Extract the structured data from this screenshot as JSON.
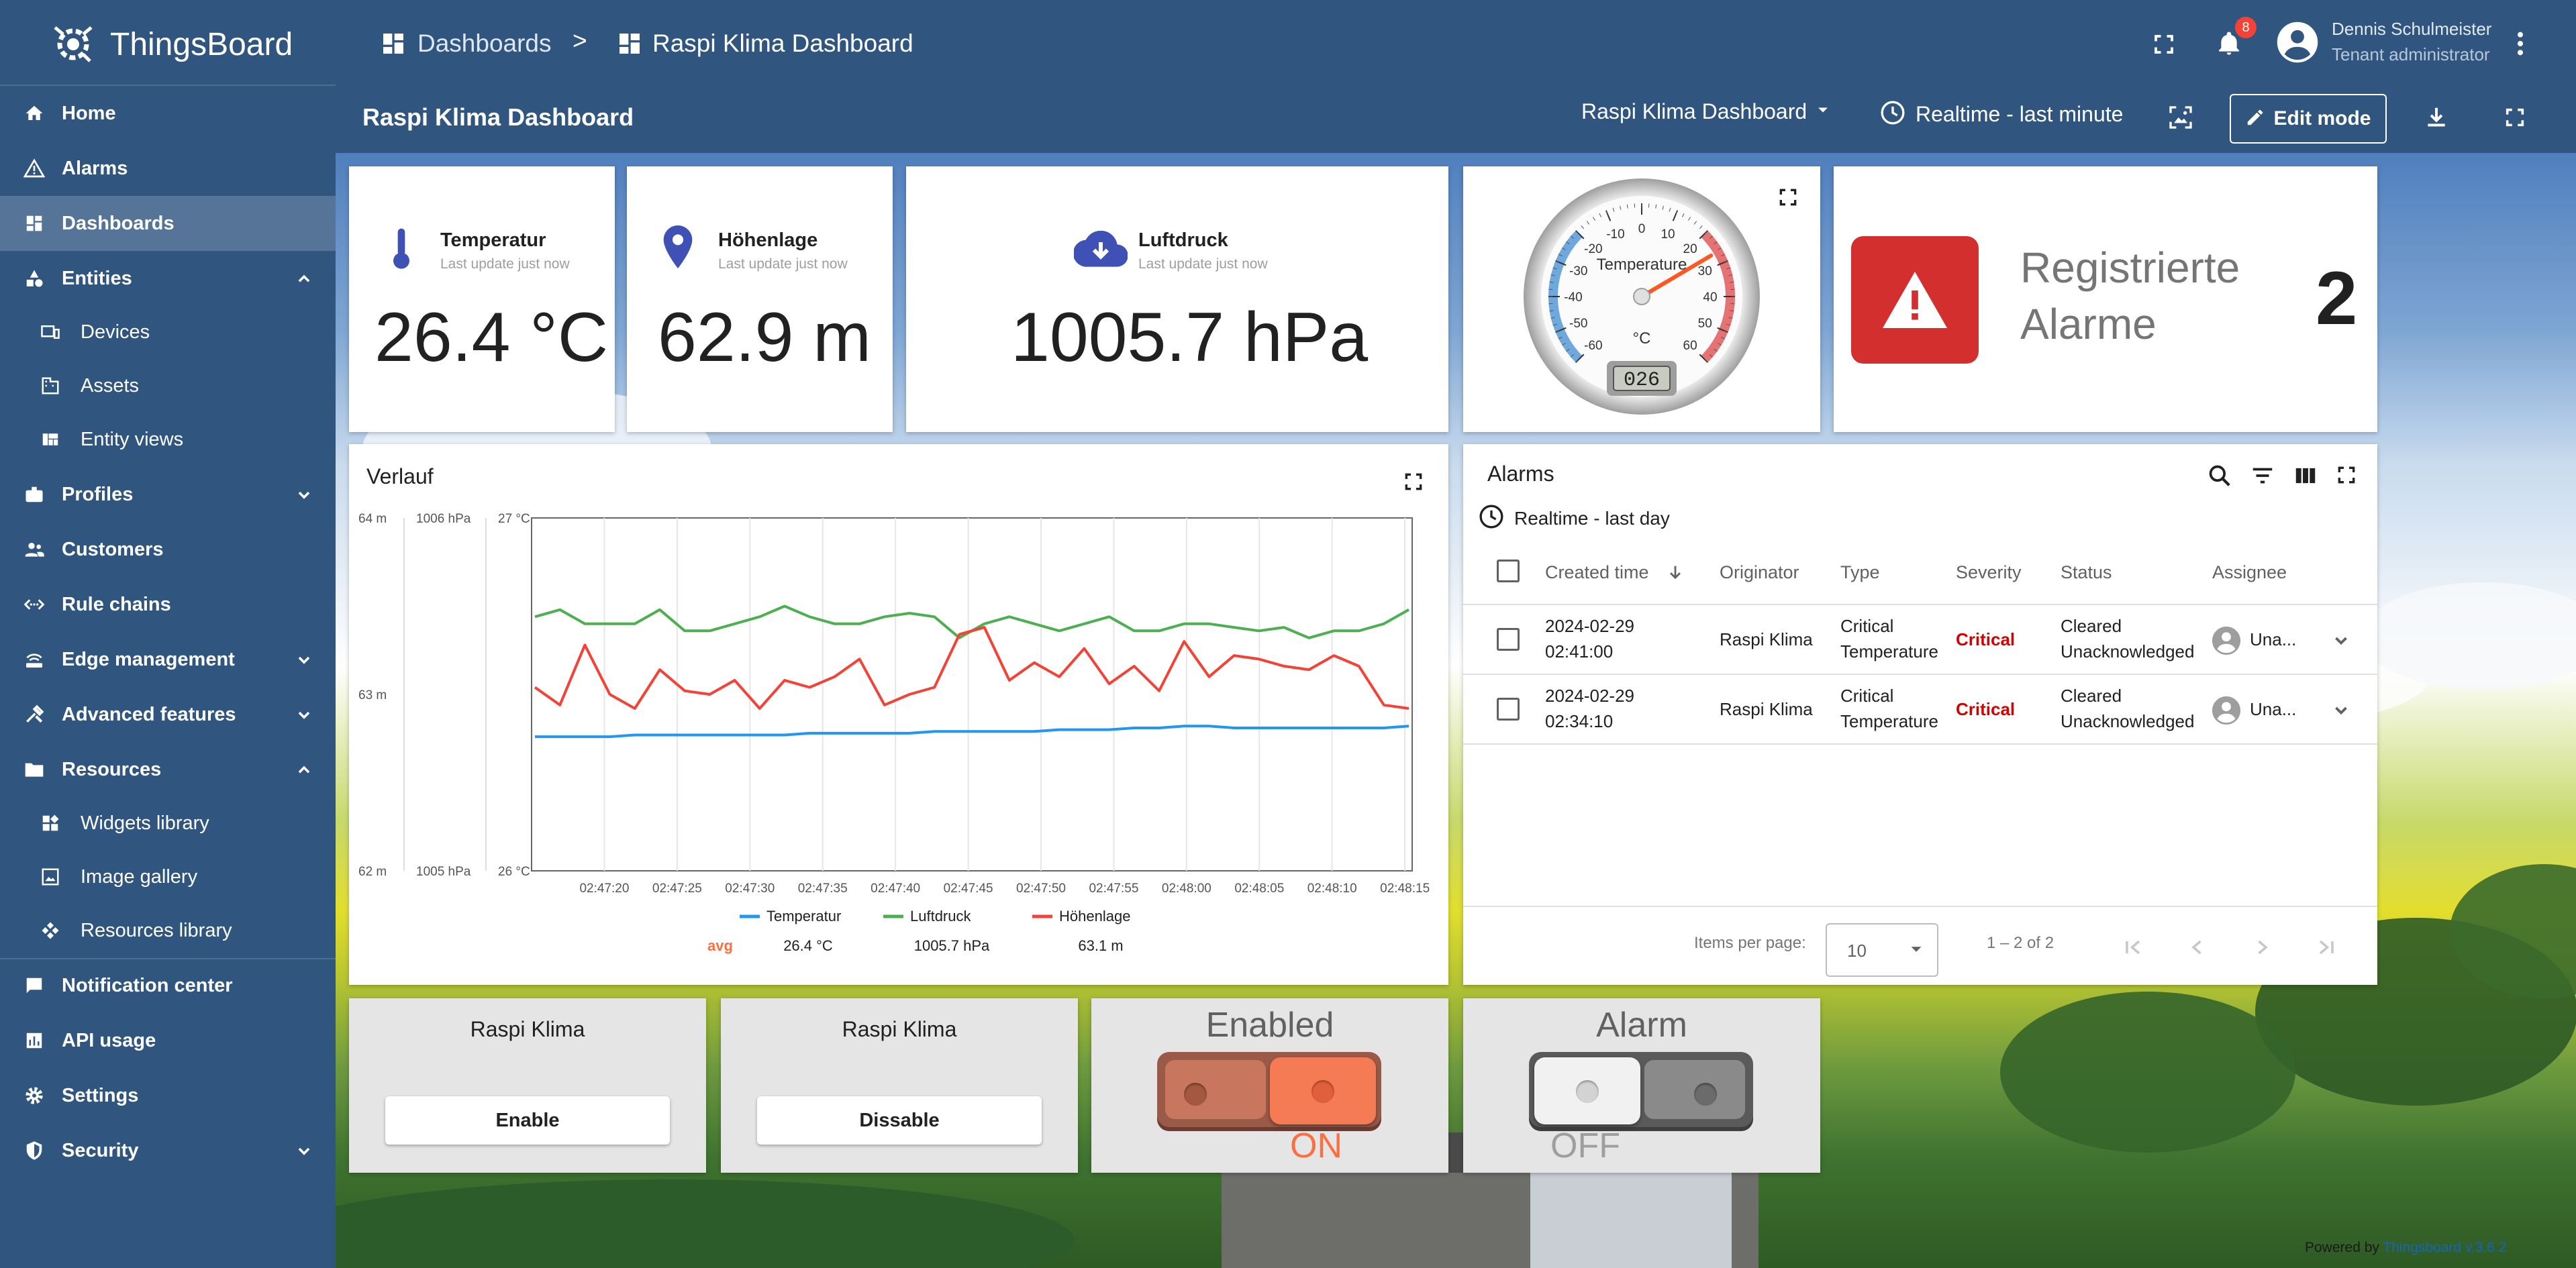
{
  "app": {
    "logo_text": "ThingsBoard"
  },
  "sidebar": {
    "items": [
      {
        "label": "Home",
        "icon": "home-icon"
      },
      {
        "label": "Alarms",
        "icon": "warning-icon"
      },
      {
        "label": "Dashboards",
        "icon": "dashboard-icon"
      },
      {
        "label": "Entities",
        "icon": "entities-icon"
      },
      {
        "label": "Devices",
        "icon": "devices-icon"
      },
      {
        "label": "Assets",
        "icon": "domain-icon"
      },
      {
        "label": "Entity views",
        "icon": "view-quilt-icon"
      },
      {
        "label": "Profiles",
        "icon": "badge-icon"
      },
      {
        "label": "Customers",
        "icon": "supervisor-icon"
      },
      {
        "label": "Rule chains",
        "icon": "settings-ethernet-icon"
      },
      {
        "label": "Edge management",
        "icon": "router-icon"
      },
      {
        "label": "Advanced features",
        "icon": "construction-icon"
      },
      {
        "label": "Resources",
        "icon": "folder-icon"
      },
      {
        "label": "Widgets library",
        "icon": "now-widgets-icon"
      },
      {
        "label": "Image gallery",
        "icon": "image-icon"
      },
      {
        "label": "Resources library",
        "icon": "mediation-icon"
      },
      {
        "label": "Notification center",
        "icon": "mark-chat-icon"
      },
      {
        "label": "API usage",
        "icon": "insert-chart-icon"
      },
      {
        "label": "Settings",
        "icon": "gear-icon"
      },
      {
        "label": "Security",
        "icon": "security-icon"
      }
    ]
  },
  "header": {
    "breadcrumb_1": "Dashboards",
    "breadcrumb_sep": ">",
    "breadcrumb_2": "Raspi Klima Dashboard",
    "notification_count": "8",
    "user_name": "Dennis Schulmeister",
    "user_role": "Tenant administrator"
  },
  "toolbar": {
    "title": "Raspi Klima Dashboard",
    "dashboard_select": "Raspi Klima Dashboard",
    "timewindow": "Realtime - last minute",
    "edit_label": "Edit mode"
  },
  "cards": {
    "temp": {
      "title": "Temperatur",
      "sub": "Last update just now",
      "value": "26.4 °C"
    },
    "height": {
      "title": "Höhenlage",
      "sub": "Last update just now",
      "value": "62.9 m"
    },
    "pressure": {
      "title": "Luftdruck",
      "sub": "Last update just now",
      "value": "1005.7 hPa"
    }
  },
  "gauge": {
    "title": "Temperature",
    "unit": "°C",
    "value_display": "026",
    "value": 26.4,
    "min": -60,
    "max": 60,
    "ticks": [
      "-60",
      "-50",
      "-40",
      "-30",
      "-20",
      "-10",
      "0",
      "10",
      "20",
      "30",
      "40",
      "50",
      "60"
    ]
  },
  "alarm_count": {
    "label_line1": "Registrierte",
    "label_line2": "Alarme",
    "value": "2",
    "color": "#d32f2f"
  },
  "chart_title": "Verlauf",
  "chart_data": {
    "type": "line",
    "title": "Verlauf",
    "x_ticks": [
      "02:47:20",
      "02:47:25",
      "02:47:30",
      "02:47:35",
      "02:47:40",
      "02:47:45",
      "02:47:50",
      "02:47:55",
      "02:48:00",
      "02:48:05",
      "02:48:10",
      "02:48:15"
    ],
    "y_axes": [
      {
        "unit": "m",
        "min": 62,
        "max": 64,
        "ticks": [
          "62 m",
          "63 m",
          "64 m"
        ]
      },
      {
        "unit": "hPa",
        "min": 1005,
        "max": 1006,
        "ticks": [
          "1005 hPa",
          "1006 hPa"
        ]
      },
      {
        "unit": "°C",
        "min": 26,
        "max": 27,
        "ticks": [
          "26 °C",
          "27 °C"
        ]
      }
    ],
    "series": [
      {
        "name": "Temperatur",
        "axis": 2,
        "color": "#2196f3",
        "values": [
          26.38,
          26.38,
          26.38,
          26.38,
          26.385,
          26.385,
          26.385,
          26.385,
          26.385,
          26.385,
          26.385,
          26.39,
          26.39,
          26.39,
          26.39,
          26.39,
          26.395,
          26.395,
          26.395,
          26.395,
          26.395,
          26.4,
          26.4,
          26.4,
          26.405,
          26.405,
          26.41,
          26.41,
          26.405,
          26.405,
          26.405,
          26.405,
          26.405,
          26.405,
          26.405,
          26.41
        ]
      },
      {
        "name": "Luftdruck",
        "axis": 1,
        "color": "#4caf50",
        "values": [
          1005.72,
          1005.74,
          1005.7,
          1005.7,
          1005.7,
          1005.74,
          1005.68,
          1005.68,
          1005.7,
          1005.72,
          1005.75,
          1005.72,
          1005.7,
          1005.7,
          1005.72,
          1005.73,
          1005.72,
          1005.66,
          1005.7,
          1005.72,
          1005.7,
          1005.68,
          1005.7,
          1005.72,
          1005.68,
          1005.68,
          1005.7,
          1005.7,
          1005.69,
          1005.68,
          1005.69,
          1005.66,
          1005.68,
          1005.68,
          1005.7,
          1005.74
        ]
      },
      {
        "name": "Höhenlage",
        "axis": 0,
        "color": "#f44336",
        "values": [
          63.04,
          62.94,
          63.28,
          63.0,
          62.92,
          63.14,
          63.02,
          63.0,
          63.08,
          62.92,
          63.08,
          63.04,
          63.1,
          63.2,
          62.94,
          63.0,
          63.04,
          63.34,
          63.38,
          63.08,
          63.18,
          63.1,
          63.26,
          63.06,
          63.16,
          63.02,
          63.3,
          63.1,
          63.22,
          63.2,
          63.16,
          63.14,
          63.22,
          63.16,
          62.94,
          62.92
        ]
      }
    ],
    "legend": {
      "avg_label": "avg",
      "avg_values": [
        "26.4 °C",
        "1005.7 hPa",
        "63.1 m"
      ]
    }
  },
  "alarms": {
    "title": "Alarms",
    "timewindow": "Realtime - last day",
    "columns": [
      "Created time",
      "Originator",
      "Type",
      "Severity",
      "Status",
      "Assignee"
    ],
    "rows": [
      {
        "date": "2024-02-29",
        "time": "02:41:00",
        "originator": "Raspi Klima",
        "type1": "Critical",
        "type2": "Temperature",
        "severity": "Critical",
        "status1": "Cleared",
        "status2": "Unacknowledged",
        "assignee": "Una..."
      },
      {
        "date": "2024-02-29",
        "time": "02:34:10",
        "originator": "Raspi Klima",
        "type1": "Critical",
        "type2": "Temperature",
        "severity": "Critical",
        "status1": "Cleared",
        "status2": "Unacknowledged",
        "assignee": "Una..."
      }
    ],
    "paginator": {
      "items_label": "Items per page:",
      "page_size": "10",
      "range": "1 – 2 of 2"
    }
  },
  "controls": {
    "enable": {
      "title": "Raspi Klima",
      "button": "Enable"
    },
    "disable": {
      "title": "Raspi Klima",
      "button": "Dissable"
    },
    "switch_enabled": {
      "title": "Enabled",
      "state": "ON",
      "on": true
    },
    "switch_alarm": {
      "title": "Alarm",
      "state": "OFF",
      "on": false
    }
  },
  "footer": {
    "powered_by": "Powered by",
    "version": "Thingsboard v.3.6.2"
  }
}
